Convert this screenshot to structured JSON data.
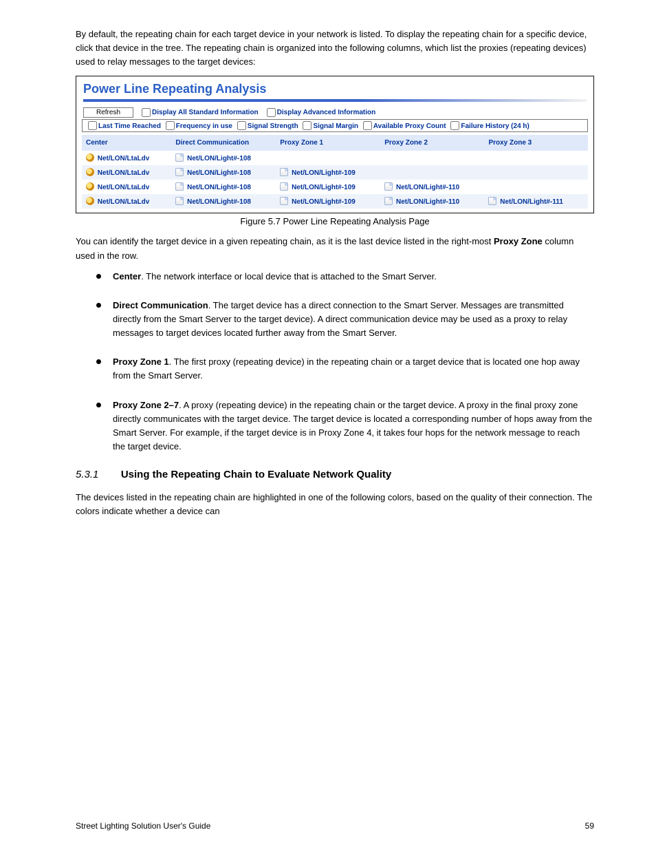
{
  "intro_para": "By default, the repeating chain for each target device in your network is listed. To display the repeating chain for a specific device, click that device in the tree. The repeating chain is organized into the following columns, which list the proxies (repeating devices) used to relay messages to the target devices:",
  "figure_caption": "Figure 5.7 Power Line Repeating Analysis Page",
  "panel": {
    "title": "Power Line Repeating Analysis",
    "refresh": "Refresh",
    "opt_std": "Display All Standard Information",
    "opt_adv": "Display Advanced Information",
    "opts2": [
      "Last Time Reached",
      "Frequency in use",
      "Signal Strength",
      "Signal Margin",
      "Available Proxy Count",
      "Failure History (24 h)"
    ],
    "cols": [
      "Center",
      "Direct Communication",
      "Proxy Zone 1",
      "Proxy Zone 2",
      "Proxy Zone 3"
    ],
    "rows": [
      {
        "c": "Net/LON/LtaLdv",
        "d": "Net/LON/Light#-108",
        "p1": "",
        "p2": "",
        "p3": ""
      },
      {
        "c": "Net/LON/LtaLdv",
        "d": "Net/LON/Light#-108",
        "p1": "Net/LON/Light#-109",
        "p2": "",
        "p3": ""
      },
      {
        "c": "Net/LON/LtaLdv",
        "d": "Net/LON/Light#-108",
        "p1": "Net/LON/Light#-109",
        "p2": "Net/LON/Light#-110",
        "p3": ""
      },
      {
        "c": "Net/LON/LtaLdv",
        "d": "Net/LON/Light#-108",
        "p1": "Net/LON/Light#-109",
        "p2": "Net/LON/Light#-110",
        "p3": "Net/LON/Light#-111"
      }
    ]
  },
  "para2_a": "You can identify the target device in a given repeating chain, as it is the last device listed in the right-most ",
  "para2_b": " column used in the row.",
  "bold_pz": "Proxy Zone",
  "bullets": [
    {
      "pre": "",
      "bold": "Center",
      "post": ". The network interface or local device that is attached to the Smart Server."
    },
    {
      "pre": "",
      "bold": "Direct Communication",
      "post": ". The target device has a direct connection to the Smart Server. Messages are transmitted directly from the Smart Server to the target device). A direct communication device may be used as a proxy to relay messages to target devices located further away from the Smart Server."
    },
    {
      "pre": "",
      "bold": "Proxy Zone 1",
      "post": ". The first proxy (repeating device) in the repeating chain or a target device that is located one hop away from the Smart Server."
    },
    {
      "pre": "",
      "bold": "Proxy Zone 2–7",
      "post": ". A proxy (repeating device) in the repeating chain or the target device. A proxy in the final proxy zone directly communicates with the target device. The target device is located a corresponding number of hops away from the Smart Server. For example, if the target device is in Proxy Zone 4, it takes four hops for the network message to reach the target device."
    }
  ],
  "section": {
    "num": "5.3.1",
    "title": "Using the Repeating Chain to Evaluate Network Quality"
  },
  "sec_para": "The devices listed in the repeating chain are highlighted in one of the following colors, based on the quality of their connection. The colors indicate whether a device can",
  "footer_left": "Street Lighting Solution User's Guide",
  "footer_right": "59"
}
